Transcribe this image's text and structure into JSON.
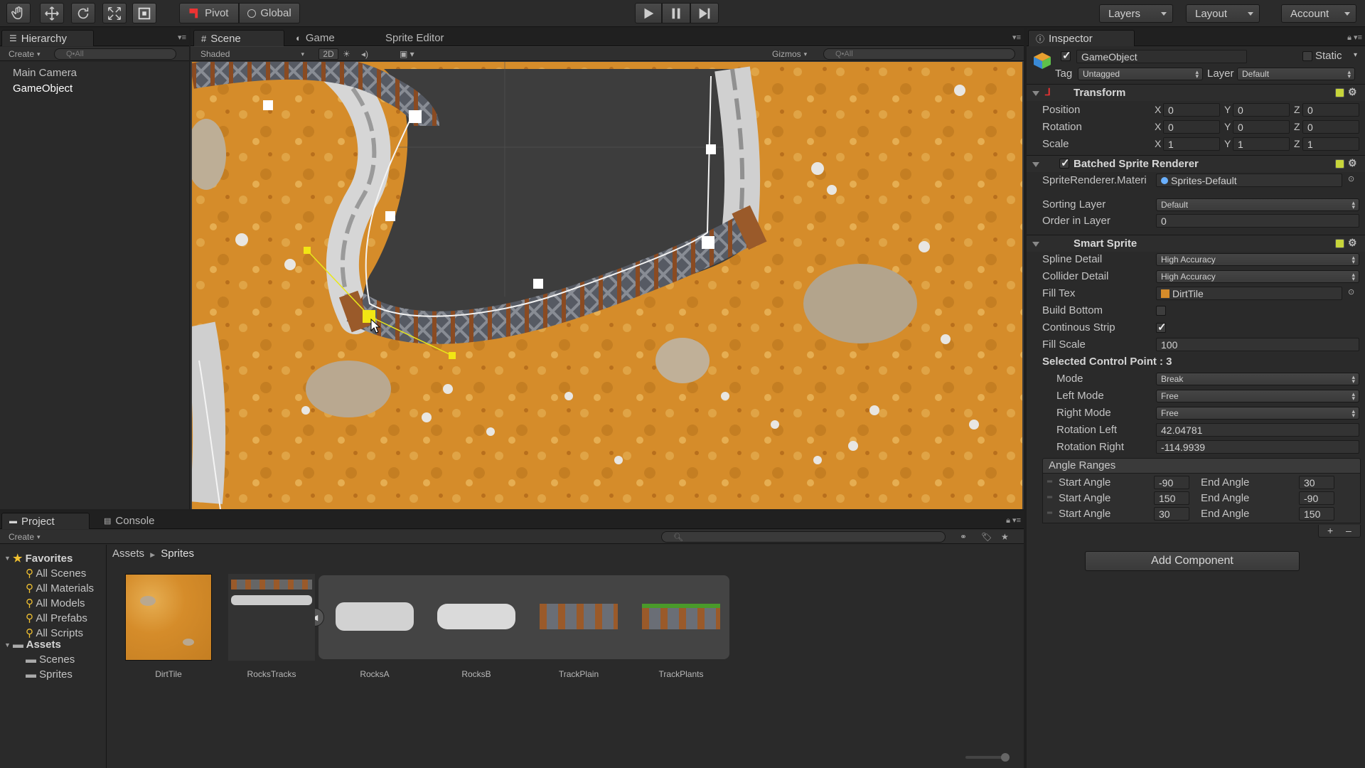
{
  "toolbar": {
    "pivot_label": "Pivot",
    "global_label": "Global",
    "layers_label": "Layers",
    "layout_label": "Layout",
    "account_label": "Account"
  },
  "hierarchy": {
    "tab_label": "Hierarchy",
    "create_label": "Create",
    "search_placeholder": "Q•All",
    "items": [
      "Main Camera",
      "GameObject"
    ]
  },
  "scene": {
    "tabs": [
      "Scene",
      "Game",
      "Sprite Editor"
    ],
    "shaded_label": "Shaded",
    "mode_2d_label": "2D",
    "gizmos_label": "Gizmos",
    "search_placeholder": "Q•All"
  },
  "inspector": {
    "tab_label": "Inspector",
    "object_name": "GameObject",
    "static_label": "Static",
    "tag_label": "Tag",
    "tag_value": "Untagged",
    "layer_label": "Layer",
    "layer_value": "Default",
    "transform": {
      "title": "Transform",
      "rows": [
        {
          "label": "Position",
          "x": "0",
          "y": "0",
          "z": "0"
        },
        {
          "label": "Rotation",
          "x": "0",
          "y": "0",
          "z": "0"
        },
        {
          "label": "Scale",
          "x": "1",
          "y": "1",
          "z": "1"
        }
      ]
    },
    "batched": {
      "title": "Batched Sprite Renderer",
      "material_label": "SpriteRenderer.Materi",
      "material_value": "Sprites-Default",
      "sorting_layer_label": "Sorting Layer",
      "sorting_layer_value": "Default",
      "order_label": "Order in Layer",
      "order_value": "0"
    },
    "smart": {
      "title": "Smart Sprite",
      "spline_detail_label": "Spline Detail",
      "spline_detail_value": "High Accuracy",
      "collider_detail_label": "Collider Detail",
      "collider_detail_value": "High Accuracy",
      "fill_tex_label": "Fill Tex",
      "fill_tex_value": "DirtTile",
      "build_bottom_label": "Build Bottom",
      "continous_strip_label": "Continous Strip",
      "fill_scale_label": "Fill Scale",
      "fill_scale_value": "100",
      "selected_cp_label": "Selected Control Point : 3",
      "mode_label": "Mode",
      "mode_value": "Break",
      "left_mode_label": "Left Mode",
      "left_mode_value": "Free",
      "right_mode_label": "Right Mode",
      "right_mode_value": "Free",
      "rotation_left_label": "Rotation Left",
      "rotation_left_value": "42.04781",
      "rotation_right_label": "Rotation Right",
      "rotation_right_value": "-114.9939",
      "angle_ranges_label": "Angle Ranges",
      "start_angle_label": "Start Angle",
      "end_angle_label": "End Angle",
      "angles": [
        {
          "start": "-90",
          "end": "30"
        },
        {
          "start": "150",
          "end": "-90"
        },
        {
          "start": "30",
          "end": "150"
        }
      ],
      "plus_label": "+",
      "minus_label": "–"
    },
    "add_component_label": "Add Component"
  },
  "project": {
    "tabs": [
      "Project",
      "Console"
    ],
    "create_label": "Create",
    "favorites_label": "Favorites",
    "favorites": [
      "All Scenes",
      "All Materials",
      "All Models",
      "All Prefabs",
      "All Scripts"
    ],
    "assets_label": "Assets",
    "folders": [
      "Scenes",
      "Sprites"
    ],
    "breadcrumb": [
      "Assets",
      "Sprites"
    ],
    "assets": [
      "DirtTile",
      "RocksTracks",
      "RocksA",
      "RocksB",
      "TrackPlain",
      "TrackPlants"
    ]
  },
  "colors": {
    "accent_yellow": "#f2e514",
    "sand": "#d9942e",
    "dark_bg": "#2a2a2a",
    "scene_bg": "#3c3c3c"
  }
}
